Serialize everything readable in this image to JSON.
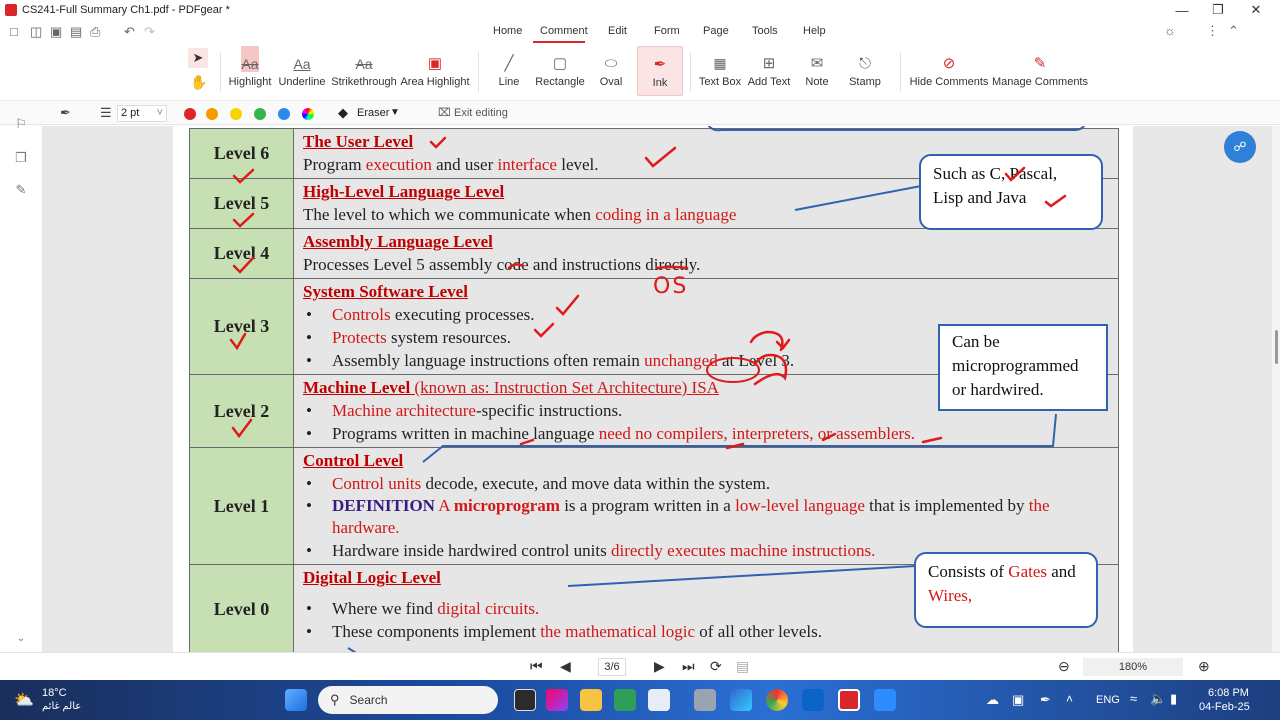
{
  "window": {
    "title": "CS241-Full Summary Ch1.pdf - PDFgear *"
  },
  "menu": {
    "items": [
      "Home",
      "Comment",
      "Edit",
      "Form",
      "Page",
      "Tools",
      "Help"
    ],
    "active": "Comment"
  },
  "ribbon": {
    "highlight": "Highlight",
    "underline": "Underline",
    "strikethrough": "Strikethrough",
    "area_highlight": "Area Highlight",
    "line": "Line",
    "rectangle": "Rectangle",
    "oval": "Oval",
    "ink": "Ink",
    "text_box": "Text Box",
    "add_text": "Add Text",
    "note": "Note",
    "stamp": "Stamp",
    "hide_comments": "Hide Comments",
    "manage_comments": "Manage Comments"
  },
  "annot_bar": {
    "stroke_width": "2 pt",
    "eraser": "Eraser",
    "exit_editing": "Exit editing",
    "colors": [
      "#e02424",
      "#f59b00",
      "#f5d400",
      "#33b64a",
      "#2c8be8"
    ]
  },
  "document": {
    "level6": {
      "label": "Level 6",
      "heading": "The User Level",
      "t1": "Program ",
      "t2": "execution",
      "t3": " and user ",
      "t4": "interface",
      "t5": " level."
    },
    "level5": {
      "label": "Level 5",
      "heading": "High-Level Language Level",
      "t1": "The level to which we communicate when ",
      "t2": "coding in a language"
    },
    "level4": {
      "label": "Level 4",
      "heading": "Assembly Language Level",
      "t1": "Processes Level 5 assembly code and instructions directly."
    },
    "level3": {
      "label": "Level 3",
      "heading": "System Software Level",
      "b1a": "Controls",
      "b1b": " executing processes.",
      "b2a": "Protects",
      "b2b": " system resources.",
      "b3a": "Assembly language instructions often remain ",
      "b3b": "unchanged",
      "b3c": " at Level 3."
    },
    "level2": {
      "label": "Level 2",
      "heading": "Machine Level ",
      "heading_paren": "(known as: Instruction Set Architecture) ISA",
      "b1a": "Machine architecture",
      "b1b": "-specific instructions.",
      "b2a": "Programs written in machine language ",
      "b2b": "need no compilers, interpreters, or assemblers."
    },
    "level1": {
      "label": "Level 1",
      "heading": "Control Level",
      "b1a": "Control units",
      "b1b": " decode, execute, and move data within the system.",
      "b2a": "DEFINITION",
      "b2b": " A ",
      "b2c": "microprogram",
      "b2d": " is a program written in a ",
      "b2e": "low-level language",
      "b2f": " that is implemented by ",
      "b2g": "the hardware.",
      "b3a": "Hardware inside hardwired control units ",
      "b3b": "directly executes machine instructions."
    },
    "level0": {
      "label": "Level 0",
      "heading": "Digital Logic Level",
      "b1a": "Where we find ",
      "b1b": "digital circuits.",
      "b2a": "These components implement ",
      "b2b": "the mathematical logic",
      "b2c": " of all other levels."
    },
    "callout_languages": "Such as C, Pascal, Lisp and Java",
    "callout_micro": "Can be microprogrammed or hardwired.",
    "callout_gates": {
      "a": "Consists of ",
      "b": "Gates",
      "c": " and ",
      "d": "Wires,"
    },
    "ink_os": "OS"
  },
  "nav": {
    "page": "3/6",
    "zoom": "180%"
  },
  "taskbar": {
    "weather_temp": "18°C",
    "weather_sub": "عالم غائم",
    "search": "Search",
    "lang": "ENG",
    "time": "6:08 PM",
    "date": "04-Feb-25"
  }
}
